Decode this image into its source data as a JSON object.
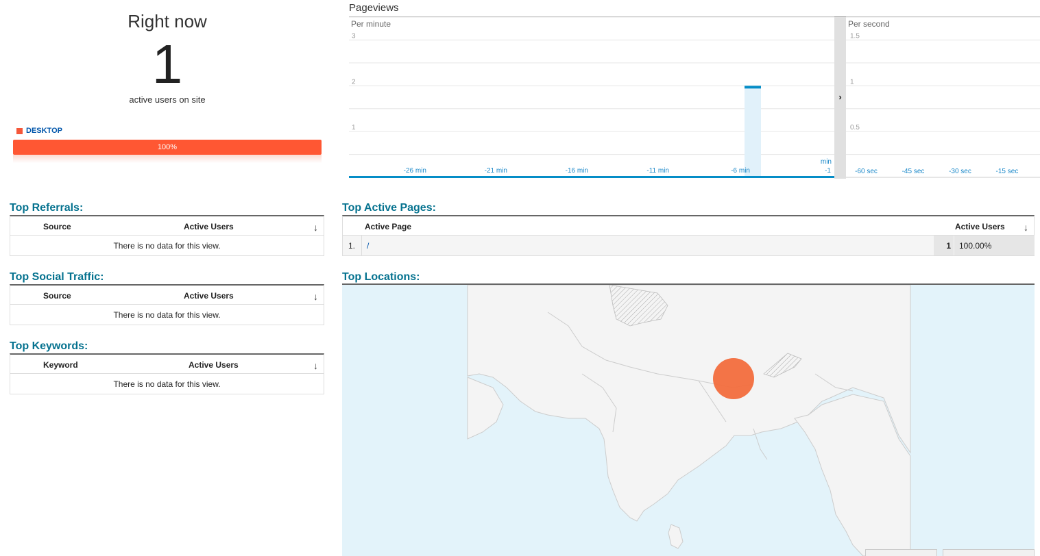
{
  "right_now": {
    "title": "Right now",
    "count": "1",
    "subtitle": "active users on site",
    "device": {
      "label": "DESKTOP",
      "percent_label": "100%",
      "fraction": 1.0,
      "color": "#ff5733"
    }
  },
  "pageviews": {
    "title": "Pageviews",
    "toggle_icon": "chevron-right-icon",
    "toggle_glyph": "›"
  },
  "chart_data": [
    {
      "type": "bar",
      "title": "Per minute",
      "x": [
        -30,
        -29,
        -28,
        -27,
        -26,
        -25,
        -24,
        -23,
        -22,
        -21,
        -20,
        -19,
        -18,
        -17,
        -16,
        -15,
        -14,
        -13,
        -12,
        -11,
        -10,
        -9,
        -8,
        -7,
        -6,
        -5,
        -4,
        -3,
        -2,
        -1
      ],
      "values": [
        0,
        0,
        0,
        0,
        0,
        0,
        0,
        0,
        0,
        0,
        0,
        0,
        0,
        0,
        0,
        0,
        0,
        0,
        0,
        0,
        0,
        0,
        0,
        0,
        2,
        0,
        0,
        0,
        0,
        0
      ],
      "x_ticks": [
        {
          "x": -26,
          "label": "-26 min"
        },
        {
          "x": -21,
          "label": "-21 min"
        },
        {
          "x": -16,
          "label": "-16 min"
        },
        {
          "x": -11,
          "label": "-11 min"
        },
        {
          "x": -6,
          "label": "-6 min"
        },
        {
          "x": -1,
          "label": "-1"
        }
      ],
      "x_unit_label": "min",
      "y_ticks": [
        "1",
        "2",
        "3"
      ],
      "ylim": [
        0,
        3.5
      ],
      "grid": true,
      "bar_color": "#058dc7"
    },
    {
      "type": "bar",
      "title": "Per second",
      "x_ticks": [
        {
          "x": -60,
          "label": "-60 sec"
        },
        {
          "x": -45,
          "label": "-45 sec"
        },
        {
          "x": -30,
          "label": "-30 sec"
        },
        {
          "x": -15,
          "label": "-15 sec"
        }
      ],
      "y_ticks": [
        "0.5",
        "1",
        "1.5"
      ],
      "ylim": [
        0,
        1.75
      ],
      "values": [],
      "grid": true
    }
  ],
  "top_referrals": {
    "title": "Top Referrals:",
    "col1": "Source",
    "col2": "Active Users",
    "sort_icon": "↓",
    "empty": "There is no data for this view."
  },
  "top_social": {
    "title": "Top Social Traffic:",
    "col1": "Source",
    "col2": "Active Users",
    "sort_icon": "↓",
    "empty": "There is no data for this view."
  },
  "top_keywords": {
    "title": "Top Keywords:",
    "col1": "Keyword",
    "col2": "Active Users",
    "sort_icon": "↓",
    "empty": "There is no data for this view."
  },
  "top_active_pages": {
    "title": "Top Active Pages:",
    "col1": "Active Page",
    "col2": "Active Users",
    "sort_icon": "↓",
    "rows": [
      {
        "num": "1.",
        "page": "/",
        "count": "1",
        "percent": "100.00%"
      }
    ]
  },
  "top_locations": {
    "title": "Top Locations:",
    "marker_color": "#f26d3d"
  }
}
